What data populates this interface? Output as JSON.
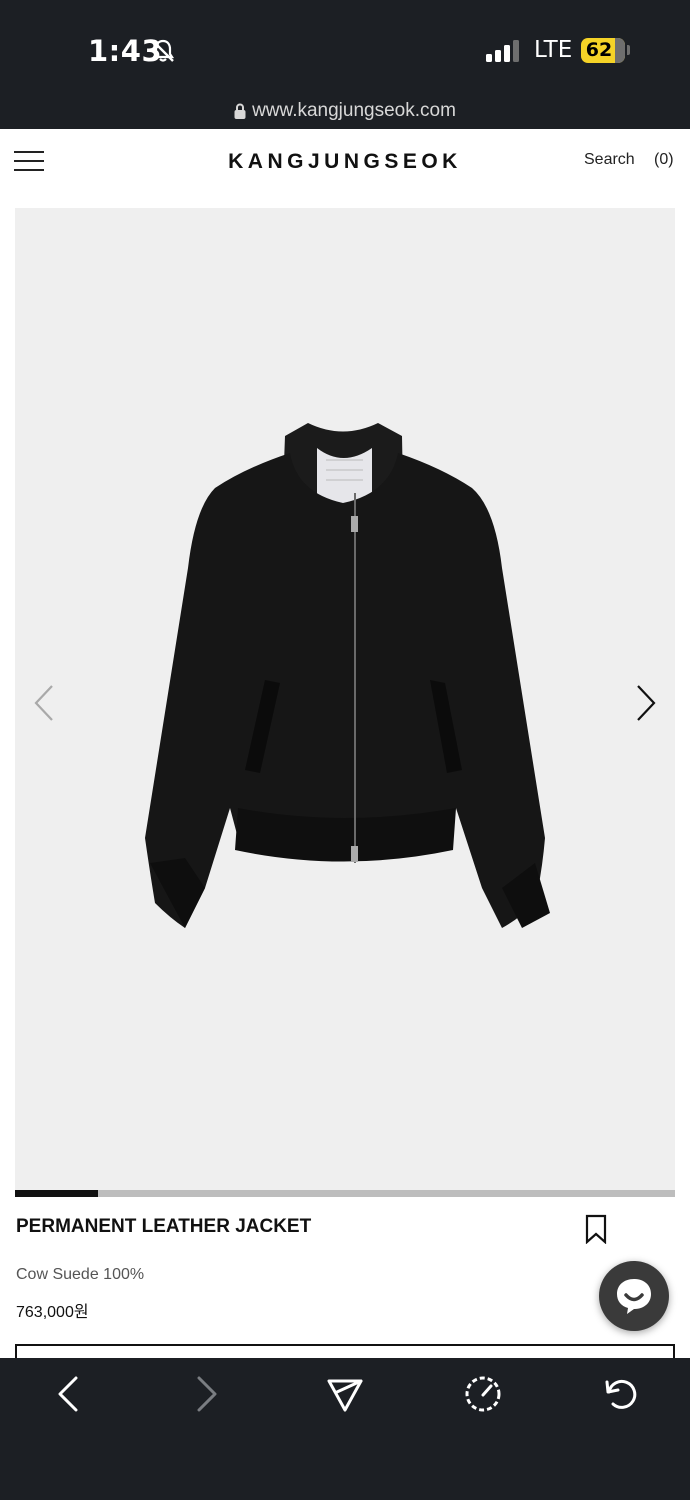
{
  "status_bar": {
    "time": "1:43",
    "network": "LTE",
    "battery": "62",
    "battery_color": "#f5d327"
  },
  "browser": {
    "url": "www.kangjungseok.com"
  },
  "header": {
    "logo": "KANGJUNGSEOK",
    "search_label": "Search",
    "cart_label": "(0)"
  },
  "gallery": {
    "slide_progress": 0.125,
    "image_subject": "black suede bomber jacket"
  },
  "product": {
    "title": "PERMANENT LEATHER JACKET",
    "material": "Cow Suede 100%",
    "price": "763,000원"
  },
  "icons": {
    "menu": "hamburger-menu-icon",
    "prev": "chevron-left-icon",
    "next": "chevron-right-icon",
    "bookmark": "bookmark-icon",
    "chat": "chat-icon",
    "back": "back-icon",
    "forward": "forward-icon",
    "share": "share-icon",
    "speed": "speed-icon",
    "reload": "reload-icon"
  },
  "colors": {
    "background_dark": "#1c1f24",
    "image_bg": "#efefef",
    "accent": "#111111"
  }
}
